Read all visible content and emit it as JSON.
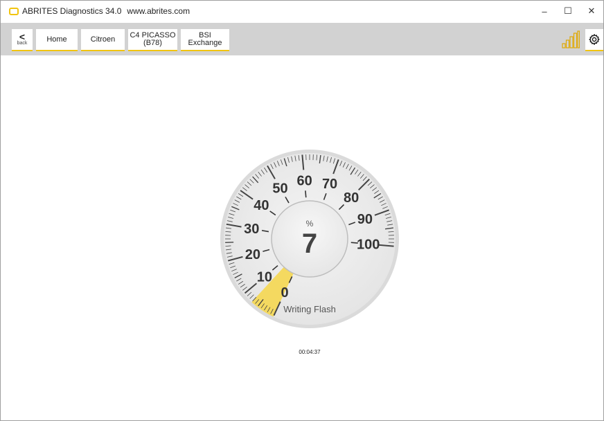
{
  "window": {
    "title": "ABRITES Diagnostics 34.0",
    "url": "www.abrites.com",
    "minimize_glyph": "–",
    "maximize_glyph": "☐",
    "close_glyph": "✕"
  },
  "toolbar": {
    "back_glyph": "<",
    "back_label": "back",
    "breadcrumbs": [
      {
        "line1": "Home",
        "line2": ""
      },
      {
        "line1": "Citroen",
        "line2": ""
      },
      {
        "line1": "C4 PICASSO",
        "line2": "(B78)"
      },
      {
        "line1": "BSI",
        "line2": "Exchange"
      }
    ],
    "signal_icon": "signal-bars-icon",
    "settings_icon": "gear-icon"
  },
  "gauge": {
    "unit": "%",
    "value": 7,
    "value_text": "7",
    "label": "Writing Flash",
    "scale_min": 0,
    "scale_max": 100,
    "major_ticks": [
      "0",
      "10",
      "20",
      "30",
      "40",
      "50",
      "60",
      "70",
      "80",
      "90",
      "100"
    ],
    "accent_color": "#f4d960"
  },
  "elapsed_time": "00:04:37"
}
